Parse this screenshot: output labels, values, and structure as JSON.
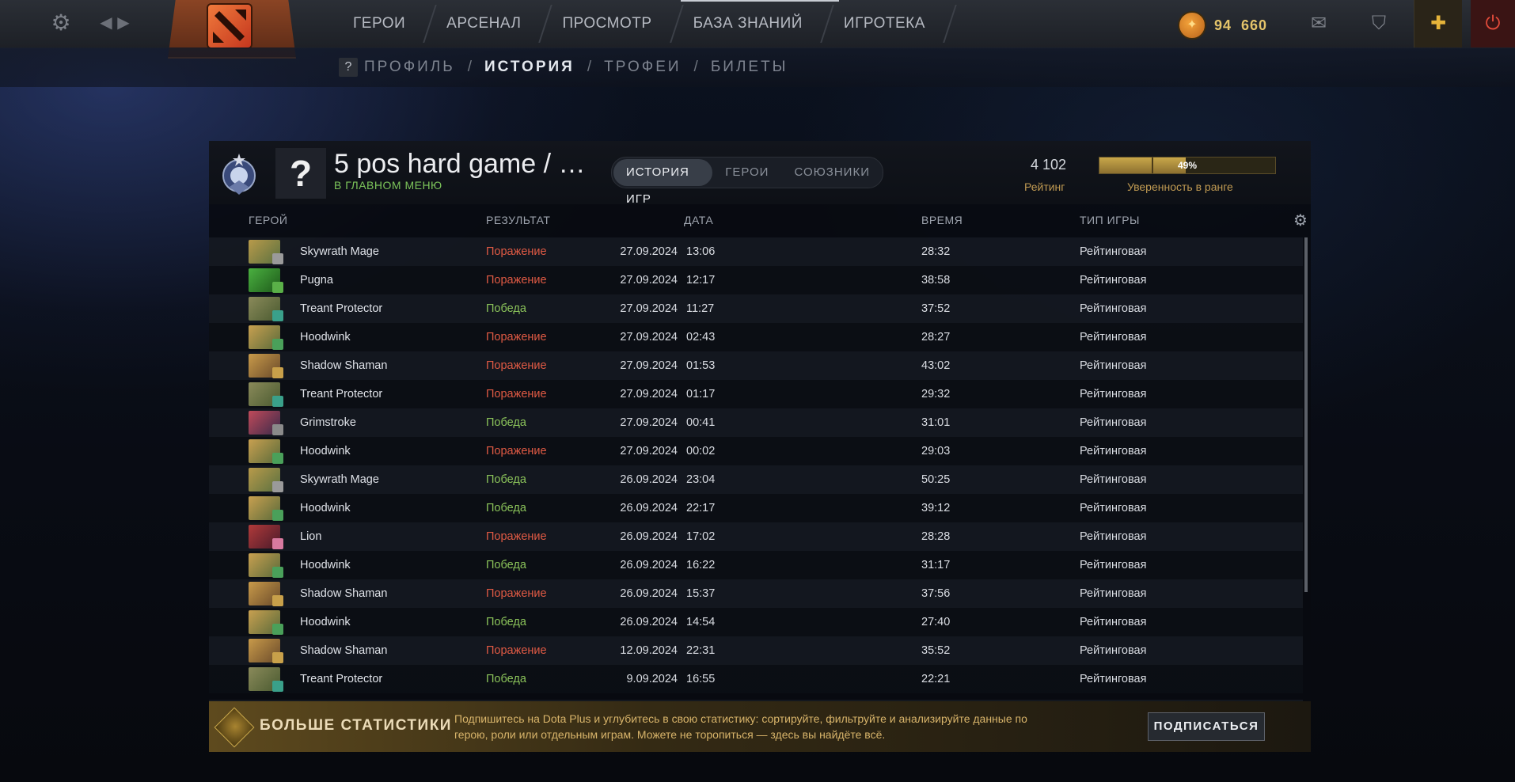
{
  "topnav": {
    "items": [
      "ГЕРОИ",
      "АРСЕНАЛ",
      "ПРОСМОТР",
      "БАЗА ЗНАНИЙ",
      "ИГРОТЕКА"
    ],
    "currency_small": "94",
    "currency_big": "660"
  },
  "subnav": {
    "help": "?",
    "profile": "ПРОФИЛЬ",
    "history": "ИСТОРИЯ",
    "trophies": "ТРОФЕИ",
    "tickets": "БИЛЕТЫ",
    "sep": "/"
  },
  "player": {
    "avatar_glyph": "?",
    "name": "5 pos hard game / …",
    "status": "В ГЛАВНОМ МЕНЮ",
    "rating": "4 102",
    "rating_label": "Рейтинг",
    "confidence": 0.49,
    "confidence_text": "49%",
    "confidence_label": "Уверенность в ранге"
  },
  "tabs": [
    "ИСТОРИЯ ИГР",
    "ГЕРОИ",
    "СОЮЗНИКИ"
  ],
  "columns": {
    "hero": "ГЕРОЙ",
    "result": "РЕЗУЛЬТАТ",
    "date": "ДАТА",
    "time": "ВРЕМЯ",
    "type": "ТИП ИГРЫ"
  },
  "colors": {
    "win": "#8bc35a",
    "loss": "#e05a44",
    "gold": "#c09a52"
  },
  "matches": [
    {
      "hero": "Skywrath Mage",
      "result": "Поражение",
      "win": false,
      "date": "27.09.2024",
      "time": "13:06",
      "duration": "28:32",
      "type": "Рейтинговая",
      "c1": "#b89a4a",
      "c2": "#5a7040",
      "badge": "#9a9a9a"
    },
    {
      "hero": "Pugna",
      "result": "Поражение",
      "win": false,
      "date": "27.09.2024",
      "time": "12:17",
      "duration": "38:58",
      "type": "Рейтинговая",
      "c1": "#4ab040",
      "c2": "#1e5a1a",
      "badge": "#5ab048"
    },
    {
      "hero": "Treant Protector",
      "result": "Победа",
      "win": true,
      "date": "27.09.2024",
      "time": "11:27",
      "duration": "37:52",
      "type": "Рейтинговая",
      "c1": "#8a8a5a",
      "c2": "#4a5a30",
      "badge": "#3aa08a"
    },
    {
      "hero": "Hoodwink",
      "result": "Поражение",
      "win": false,
      "date": "27.09.2024",
      "time": "02:43",
      "duration": "28:27",
      "type": "Рейтинговая",
      "c1": "#c8a050",
      "c2": "#5a6a3a",
      "badge": "#4aa05a"
    },
    {
      "hero": "Shadow Shaman",
      "result": "Поражение",
      "win": false,
      "date": "27.09.2024",
      "time": "01:53",
      "duration": "43:02",
      "type": "Рейтинговая",
      "c1": "#c89a4a",
      "c2": "#6a4a2a",
      "badge": "#c8a04a"
    },
    {
      "hero": "Treant Protector",
      "result": "Поражение",
      "win": false,
      "date": "27.09.2024",
      "time": "01:17",
      "duration": "29:32",
      "type": "Рейтинговая",
      "c1": "#8a8a5a",
      "c2": "#4a5a30",
      "badge": "#3aa08a"
    },
    {
      "hero": "Grimstroke",
      "result": "Победа",
      "win": true,
      "date": "27.09.2024",
      "time": "00:41",
      "duration": "31:01",
      "type": "Рейтинговая",
      "c1": "#c04a5a",
      "c2": "#3a2a4a",
      "badge": "#8a8a8a"
    },
    {
      "hero": "Hoodwink",
      "result": "Поражение",
      "win": false,
      "date": "27.09.2024",
      "time": "00:02",
      "duration": "29:03",
      "type": "Рейтинговая",
      "c1": "#c8a050",
      "c2": "#5a6a3a",
      "badge": "#4aa05a"
    },
    {
      "hero": "Skywrath Mage",
      "result": "Победа",
      "win": true,
      "date": "26.09.2024",
      "time": "23:04",
      "duration": "50:25",
      "type": "Рейтинговая",
      "c1": "#b89a4a",
      "c2": "#5a7040",
      "badge": "#9a9a9a"
    },
    {
      "hero": "Hoodwink",
      "result": "Победа",
      "win": true,
      "date": "26.09.2024",
      "time": "22:17",
      "duration": "39:12",
      "type": "Рейтинговая",
      "c1": "#c8a050",
      "c2": "#5a6a3a",
      "badge": "#4aa05a"
    },
    {
      "hero": "Lion",
      "result": "Поражение",
      "win": false,
      "date": "26.09.2024",
      "time": "17:02",
      "duration": "28:28",
      "type": "Рейтинговая",
      "c1": "#b03a3a",
      "c2": "#4a1a2a",
      "badge": "#d87aa0"
    },
    {
      "hero": "Hoodwink",
      "result": "Победа",
      "win": true,
      "date": "26.09.2024",
      "time": "16:22",
      "duration": "31:17",
      "type": "Рейтинговая",
      "c1": "#c8a050",
      "c2": "#5a6a3a",
      "badge": "#4aa05a"
    },
    {
      "hero": "Shadow Shaman",
      "result": "Поражение",
      "win": false,
      "date": "26.09.2024",
      "time": "15:37",
      "duration": "37:56",
      "type": "Рейтинговая",
      "c1": "#c89a4a",
      "c2": "#6a4a2a",
      "badge": "#c8a04a"
    },
    {
      "hero": "Hoodwink",
      "result": "Победа",
      "win": true,
      "date": "26.09.2024",
      "time": "14:54",
      "duration": "27:40",
      "type": "Рейтинговая",
      "c1": "#c8a050",
      "c2": "#5a6a3a",
      "badge": "#4aa05a"
    },
    {
      "hero": "Shadow Shaman",
      "result": "Поражение",
      "win": false,
      "date": "12.09.2024",
      "time": "22:31",
      "duration": "35:52",
      "type": "Рейтинговая",
      "c1": "#c89a4a",
      "c2": "#6a4a2a",
      "badge": "#c8a04a"
    },
    {
      "hero": "Treant Protector",
      "result": "Победа",
      "win": true,
      "date": "9.09.2024",
      "time": "16:55",
      "duration": "22:21",
      "type": "Рейтинговая",
      "c1": "#8a8a5a",
      "c2": "#4a5a30",
      "badge": "#3aa08a"
    }
  ],
  "promo": {
    "title": "БОЛЬШЕ СТАТИСТИКИ",
    "text": "Подпишитесь на Dota Plus и углубитесь в свою статистику: сортируйте, фильтруйте и анализируйте данные по герою, роли или отдельным играм. Можете не торопиться — здесь вы найдёте всё.",
    "button": "ПОДПИСАТЬСЯ"
  }
}
